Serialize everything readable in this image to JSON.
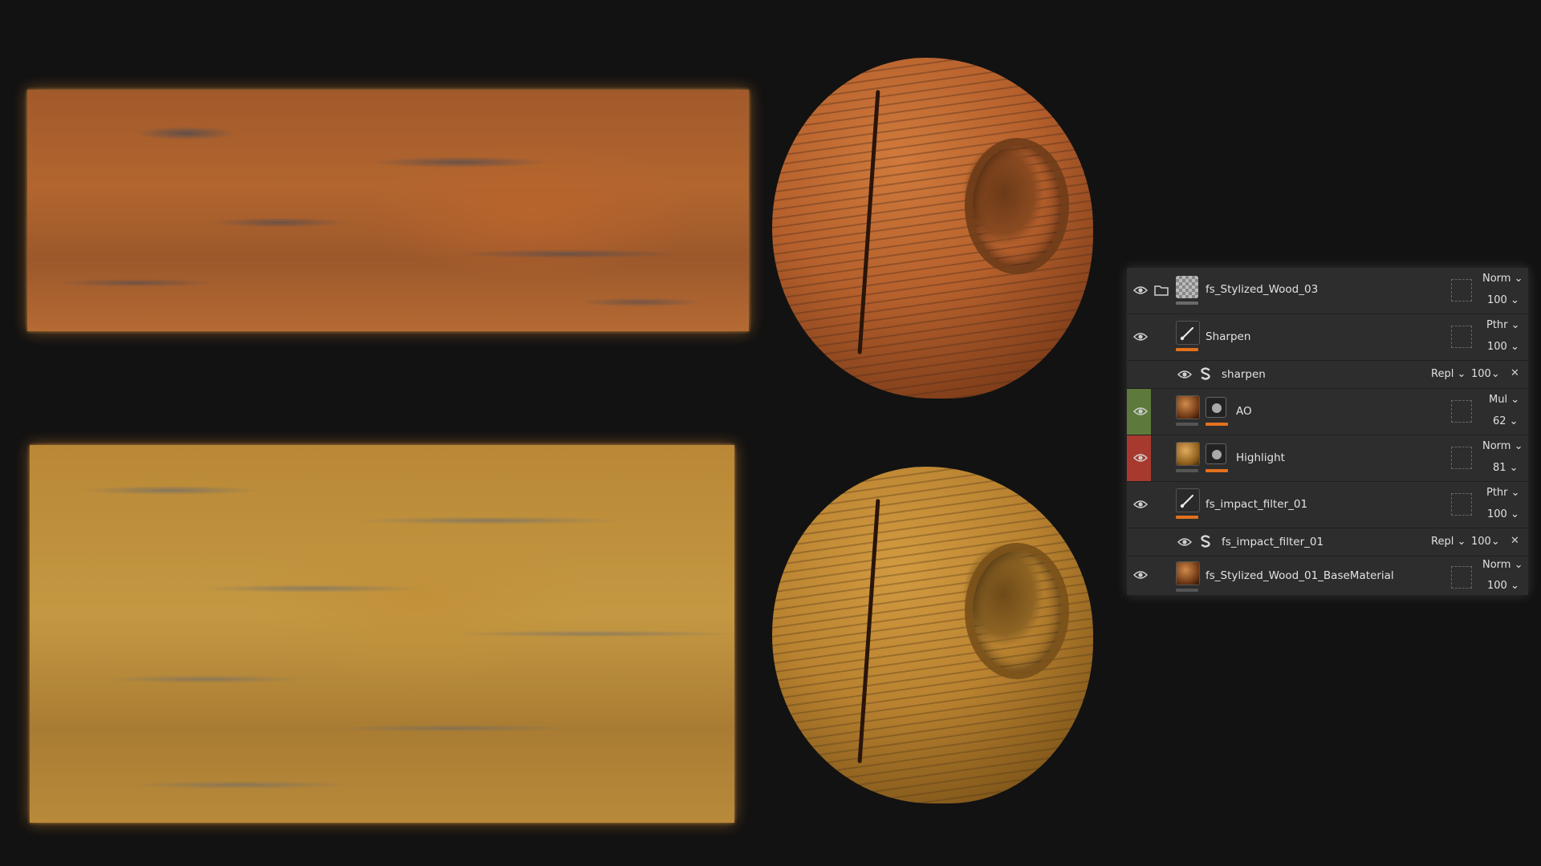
{
  "colors": {
    "accent_orange": "#e2711d",
    "strip_green": "#5d7a3c",
    "strip_red": "#a8392e",
    "panel_bg": "#2d2d2d",
    "page_bg": "#121212"
  },
  "layers": [
    {
      "name": "fs_Stylized_Wood_03",
      "blend": "Norm",
      "opacity": "100",
      "icon": "folder-icon",
      "thumb": "checker"
    },
    {
      "name": "Sharpen",
      "blend": "Pthr",
      "opacity": "100",
      "icon": "brush-icon",
      "thumb": "brush"
    },
    {
      "name": "sharpen",
      "blend": "Repl",
      "opacity": "100",
      "icon": "filter-icon",
      "sub": true
    },
    {
      "name": "AO",
      "blend": "Mul",
      "opacity": "62",
      "thumb": "ball"
    },
    {
      "name": "Highlight",
      "blend": "Norm",
      "opacity": "81",
      "thumb": "ball"
    },
    {
      "name": "fs_impact_filter_01",
      "blend": "Pthr",
      "opacity": "100",
      "icon": "brush-icon",
      "thumb": "brush"
    },
    {
      "name": "fs_impact_filter_01",
      "blend": "Repl",
      "opacity": "100",
      "icon": "filter-icon",
      "sub": true
    },
    {
      "name": "fs_Stylized_Wood_01_BaseMaterial",
      "blend": "Norm",
      "opacity": "100",
      "thumb": "ball"
    }
  ]
}
